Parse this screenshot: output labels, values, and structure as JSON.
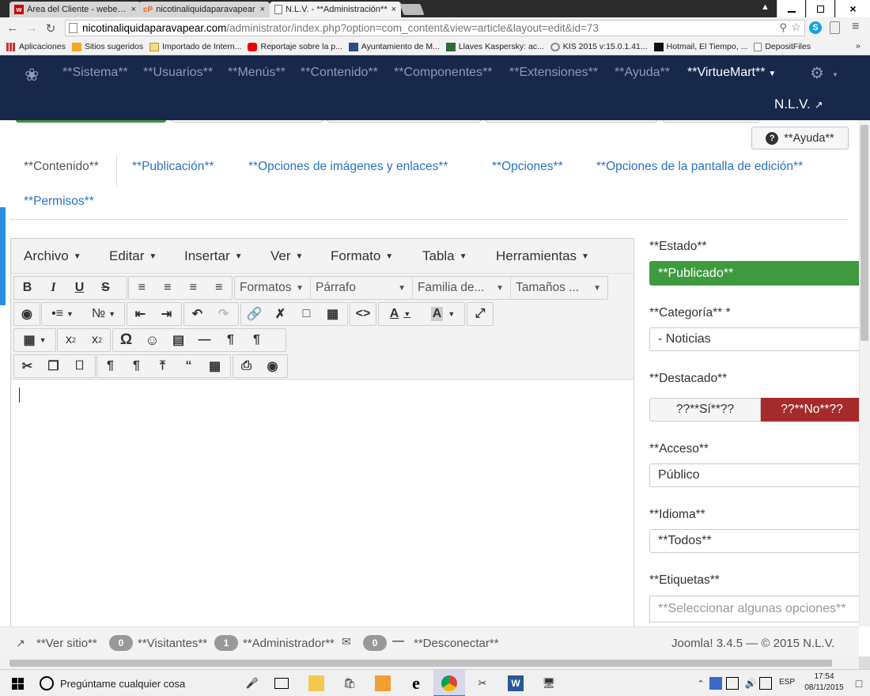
{
  "browser": {
    "tabs": [
      {
        "title": "Área del Cliente - webemp",
        "favicon": "w"
      },
      {
        "title": "nicotinaliquidaparavapear",
        "favicon": "cP"
      },
      {
        "title": "N.L.V. - **Administración**",
        "favicon": "doc"
      }
    ],
    "close_glyph": "×",
    "window_controls": [
      "minimize",
      "restore",
      "close"
    ],
    "url_host": "nicotinaliquidaparavapear.com",
    "url_path": "/administrator/index.php?option=com_content&view=article&layout=edit&id=73",
    "bookmarks": [
      "Aplicaciones",
      "Sitios sugeridos",
      "Importado de Intern...",
      "Reportaje sobre la p...",
      "Ayuntamiento de M...",
      "Llaves Kaspersky: ac...",
      "KIS 2015 v:15.0.1.41...",
      "Hotmail, El Tiempo, ...",
      "DepositFiles"
    ],
    "bookmarks_more": "»"
  },
  "admin_menu": {
    "items": [
      "**Sistema**",
      "**Usuarios**",
      "**Menús**",
      "**Contenido**",
      "**Componentes**",
      "**Extensiones**",
      "**Ayuda**"
    ],
    "virtuemart": "**VirtueMart**",
    "site_name": "N.L.V."
  },
  "help_button": "**Ayuda**",
  "article_tabs": [
    "**Contenido**",
    "**Publicación**",
    "**Opciones de imágenes y enlaces**",
    "**Opciones**",
    "**Opciones de la pantalla de edición**",
    "**Permisos**"
  ],
  "editor": {
    "menus": [
      "Archivo",
      "Editar",
      "Insertar",
      "Ver",
      "Formato",
      "Tabla",
      "Herramientas"
    ],
    "dropdowns": [
      "Formatos",
      "Párrafo",
      "Familia de...",
      "Tamaños ..."
    ]
  },
  "side_panel": {
    "status_label": "**Estado**",
    "status_value": "**Publicado**",
    "category_label": "**Categoría** *",
    "category_value": "- Noticias",
    "featured_label": "**Destacado**",
    "featured_yes": "??**Sí**??",
    "featured_no": "??**No**??",
    "access_label": "**Acceso**",
    "access_value": "Público",
    "language_label": "**Idioma**",
    "language_value": "**Todos**",
    "tags_label": "**Etiquetas**",
    "tags_placeholder": "**Seleccionar algunas opciones**"
  },
  "footer": {
    "view_site": "**Ver sitio**",
    "visitors_count": "0",
    "visitors_label": "**Visitantes**",
    "admin_count": "1",
    "admin_label": "**Administrador**",
    "messages_count": "0",
    "logout": "**Desconectar**",
    "version": "Joomla! 3.4.5  —  © 2015 N.L.V."
  },
  "taskbar": {
    "search_placeholder": "Pregúntame cualquier cosa",
    "language": "ESP",
    "time": "17:54",
    "date": "08/11/2015"
  },
  "colors": {
    "navbar": "#17284a",
    "published": "#3f9a3f",
    "featured_no": "#a52a2a",
    "tab_link": "#2a74c0"
  }
}
